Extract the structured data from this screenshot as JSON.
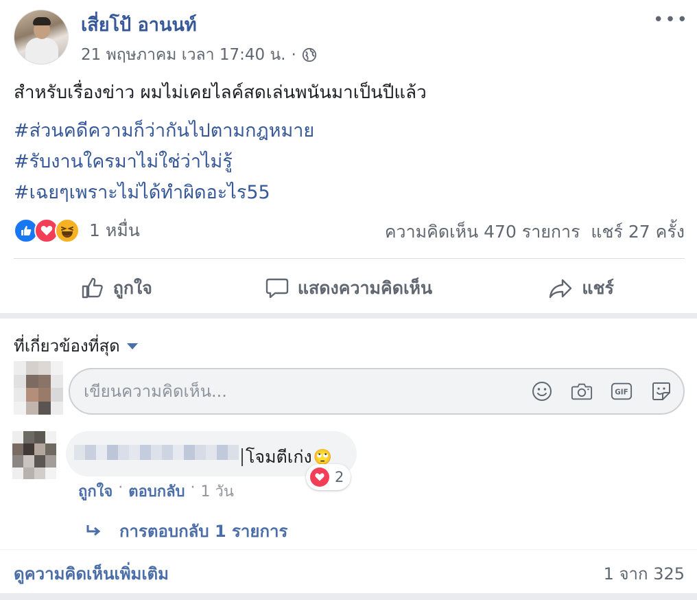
{
  "post": {
    "author": "เสี่ยโป้ อานนท์",
    "timestamp": "21 พฤษภาคม เวลา 17:40 น.",
    "meta_separator": "·",
    "more_icon": "•••",
    "text": "สำหรับเรื่องข่าว ผมไม่เคยไลค์สดเล่นพนันมาเป็นปีแล้ว",
    "hashtags": [
      "#ส่วนคดีความก็ว่ากันไปตามกฎหมาย",
      "#รับงานใครมาไม่ใช่ว่าไม่รู้",
      "#เฉยๆเพราะไม่ได้ทำผิดอะไร55"
    ]
  },
  "stats": {
    "reaction_count": "1 หมื่น",
    "comments": "ความคิดเห็น 470 รายการ",
    "shares": "แชร์ 27 ครั้ง",
    "reactions": [
      "like-reaction-icon",
      "love-reaction-icon",
      "haha-reaction-icon"
    ]
  },
  "actions": {
    "like": "ถูกใจ",
    "comment": "แสดงความคิดเห็น",
    "share": "แชร์"
  },
  "comments_section": {
    "sort_label": "ที่เกี่ยวข้องที่สุด",
    "composer_placeholder": "เขียนความคิดเห็น...",
    "composer_icons": [
      "emoji-icon",
      "camera-icon",
      "gif-icon",
      "sticker-icon"
    ],
    "comment": {
      "text": "โจมตีเก่ง",
      "emoji": "🙄",
      "reaction_count": "2",
      "like_label": "ถูกใจ",
      "reply_label": "ตอบกลับ",
      "time": "1 วัน",
      "separator": "·"
    },
    "replies_label": "การตอบกลับ 1 รายการ",
    "more_comments": "ดูความคิดเห็นเพิ่มเติม",
    "pager": "1 จาก 325"
  },
  "colors": {
    "link": "#365899",
    "secondary_text": "#606770",
    "like_blue": "#1877f2",
    "love_red": "#f33e58",
    "haha_yellow": "#f7b125"
  }
}
